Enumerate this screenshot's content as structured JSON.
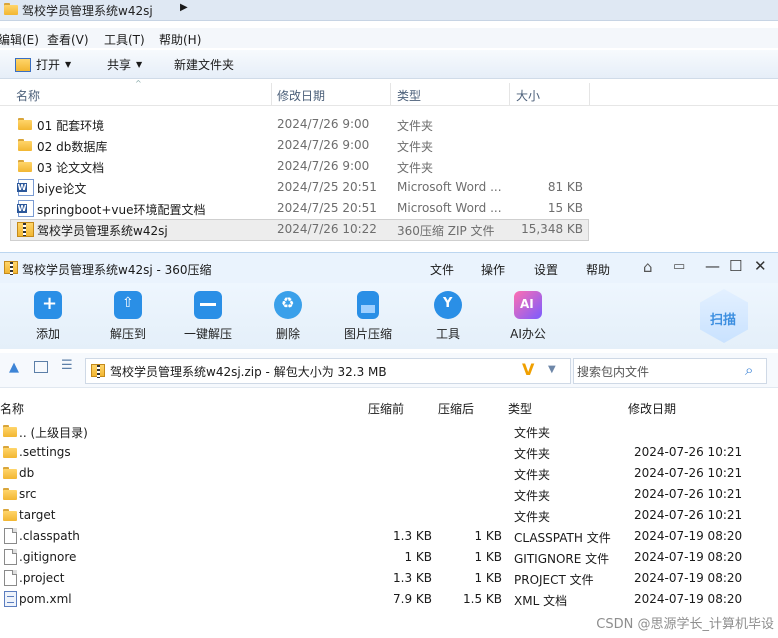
{
  "explorer": {
    "path_title": "驾校学员管理系统w42sj",
    "menu": [
      "编辑(E)",
      "查看(V)",
      "工具(T)",
      "帮助(H)"
    ],
    "commands": {
      "open": "打开",
      "share": "共享",
      "new_folder": "新建文件夹"
    },
    "columns": {
      "name": "名称",
      "modified": "修改日期",
      "type": "类型",
      "size": "大小"
    },
    "rows": [
      {
        "icon": "folder-icon",
        "name": "01 配套环境",
        "date": "2024/7/26 9:00",
        "type": "文件夹",
        "size": ""
      },
      {
        "icon": "folder-icon",
        "name": "02 db数据库",
        "date": "2024/7/26 9:00",
        "type": "文件夹",
        "size": ""
      },
      {
        "icon": "folder-icon",
        "name": "03 论文文档",
        "date": "2024/7/26 9:00",
        "type": "文件夹",
        "size": ""
      },
      {
        "icon": "word-doc-icon",
        "name": "biye论文",
        "date": "2024/7/25 20:51",
        "type": "Microsoft Word ...",
        "size": "81 KB"
      },
      {
        "icon": "word-doc-icon",
        "name": "springboot+vue环境配置文档",
        "date": "2024/7/25 20:51",
        "type": "Microsoft Word ...",
        "size": "15 KB"
      },
      {
        "icon": "zip-archive-icon",
        "name": "驾校学员管理系统w42sj",
        "date": "2024/7/26 10:22",
        "type": "360压缩 ZIP 文件",
        "size": "15,348 KB"
      }
    ]
  },
  "zip_window": {
    "title": "驾校学员管理系统w42sj - 360压缩",
    "menu": [
      "文件",
      "操作",
      "设置",
      "帮助"
    ],
    "tools": [
      "添加",
      "解压到",
      "一键解压",
      "删除",
      "图片压缩",
      "工具",
      "AI办公"
    ],
    "scan_label": "扫描",
    "address": "驾校学员管理系统w42sj.zip - 解包大小为 32.3 MB",
    "search_placeholder": "搜索包内文件",
    "columns": {
      "name": "名称",
      "before": "压缩前",
      "after": "压缩后",
      "type": "类型",
      "modified": "修改日期"
    },
    "rows": [
      {
        "icon": "folder-icon",
        "name": ".. (上级目录)",
        "before": "",
        "after": "",
        "type": "文件夹",
        "date": ""
      },
      {
        "icon": "folder-icon",
        "name": ".settings",
        "before": "",
        "after": "",
        "type": "文件夹",
        "date": "2024-07-26 10:21"
      },
      {
        "icon": "folder-icon",
        "name": "db",
        "before": "",
        "after": "",
        "type": "文件夹",
        "date": "2024-07-26 10:21"
      },
      {
        "icon": "folder-icon",
        "name": "src",
        "before": "",
        "after": "",
        "type": "文件夹",
        "date": "2024-07-26 10:21"
      },
      {
        "icon": "folder-icon",
        "name": "target",
        "before": "",
        "after": "",
        "type": "文件夹",
        "date": "2024-07-26 10:21"
      },
      {
        "icon": "file-icon",
        "name": ".classpath",
        "before": "1.3 KB",
        "after": "1 KB",
        "type": "CLASSPATH 文件",
        "date": "2024-07-19 08:20"
      },
      {
        "icon": "file-icon",
        "name": ".gitignore",
        "before": "1 KB",
        "after": "1 KB",
        "type": "GITIGNORE 文件",
        "date": "2024-07-19 08:20"
      },
      {
        "icon": "file-icon",
        "name": ".project",
        "before": "1.3 KB",
        "after": "1 KB",
        "type": "PROJECT 文件",
        "date": "2024-07-19 08:20"
      },
      {
        "icon": "xml-file-icon",
        "name": "pom.xml",
        "before": "7.9 KB",
        "after": "1.5 KB",
        "type": "XML 文档",
        "date": "2024-07-19 08:20"
      }
    ]
  },
  "watermark": "CSDN @思源学长_计算机毕设"
}
